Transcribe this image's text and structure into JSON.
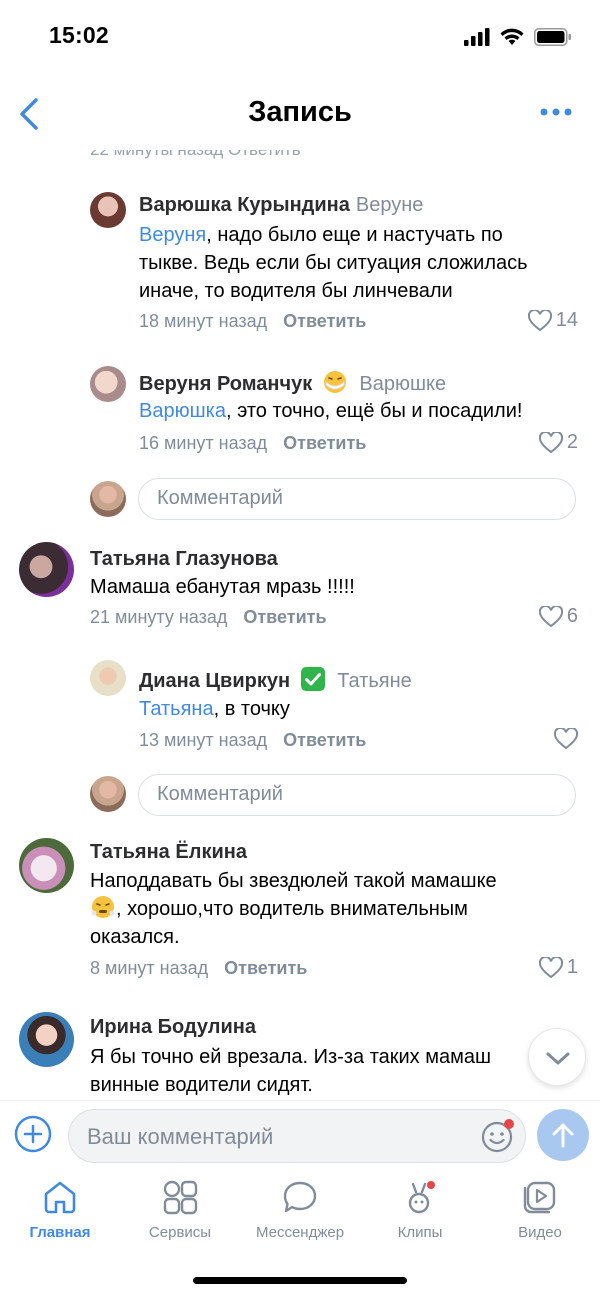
{
  "status_bar": {
    "time": "15:02"
  },
  "header": {
    "title": "Запись"
  },
  "clipped_prev_line": "22 минуты назад   Ответить",
  "comments": [
    {
      "author": "Варюшка Курындина",
      "reply_to": "Веруне",
      "mention": "Веруня",
      "text_line1_rest": ", надо было еще и настучать по",
      "text_line2": "тыкве. Ведь если бы ситуация сложилась",
      "text_line3": "иначе, то водителя бы линчевали",
      "time": "18 минут назад",
      "reply_label": "Ответить",
      "likes": "14"
    },
    {
      "author": "Веруня Романчук",
      "reply_to": "Варюшке",
      "mention": "Варюшка",
      "text_line1_rest": ", это точно, ещё бы и посадили!",
      "time": "16 минут назад",
      "reply_label": "Ответить",
      "likes": "2"
    },
    {
      "author": "Татьяна Глазунова",
      "text_line1": "Мамаша ебанутая мразь !!!!!",
      "time": "21 минуту назад",
      "reply_label": "Ответить",
      "likes": "6"
    },
    {
      "author": "Диана Цвиркун",
      "reply_to": "Татьяне",
      "mention": "Татьяна",
      "text_line1_rest": ", в точку",
      "time": "13 минут назад",
      "reply_label": "Ответить",
      "likes": ""
    },
    {
      "author": "Татьяна Ёлкина",
      "text_line1": "Наподдавать бы звездюлей такой мамашке",
      "text_line2": ", хорошо,что водитель внимательным",
      "text_line3": "оказался.",
      "time": "8 минут назад",
      "reply_label": "Ответить",
      "likes": "1"
    },
    {
      "author": "Ирина Бодулина",
      "text_line1": "Я бы точно ей врезала. Из-за таких мамаш",
      "text_line2": "винные водители сидят."
    }
  ],
  "comment_placeholder": "Комментарий",
  "input": {
    "placeholder": "Ваш комментарий"
  },
  "tabs": [
    {
      "label": "Главная",
      "icon": "home-icon",
      "active": true
    },
    {
      "label": "Сервисы",
      "icon": "services-icon",
      "active": false
    },
    {
      "label": "Мессенджер",
      "icon": "messenger-icon",
      "active": false
    },
    {
      "label": "Клипы",
      "icon": "clips-icon",
      "active": false
    },
    {
      "label": "Видео",
      "icon": "video-icon",
      "active": false
    }
  ],
  "colors": {
    "accent": "#3f8ae0",
    "secondary_text": "#818c99",
    "notification_dot": "#e64646"
  }
}
